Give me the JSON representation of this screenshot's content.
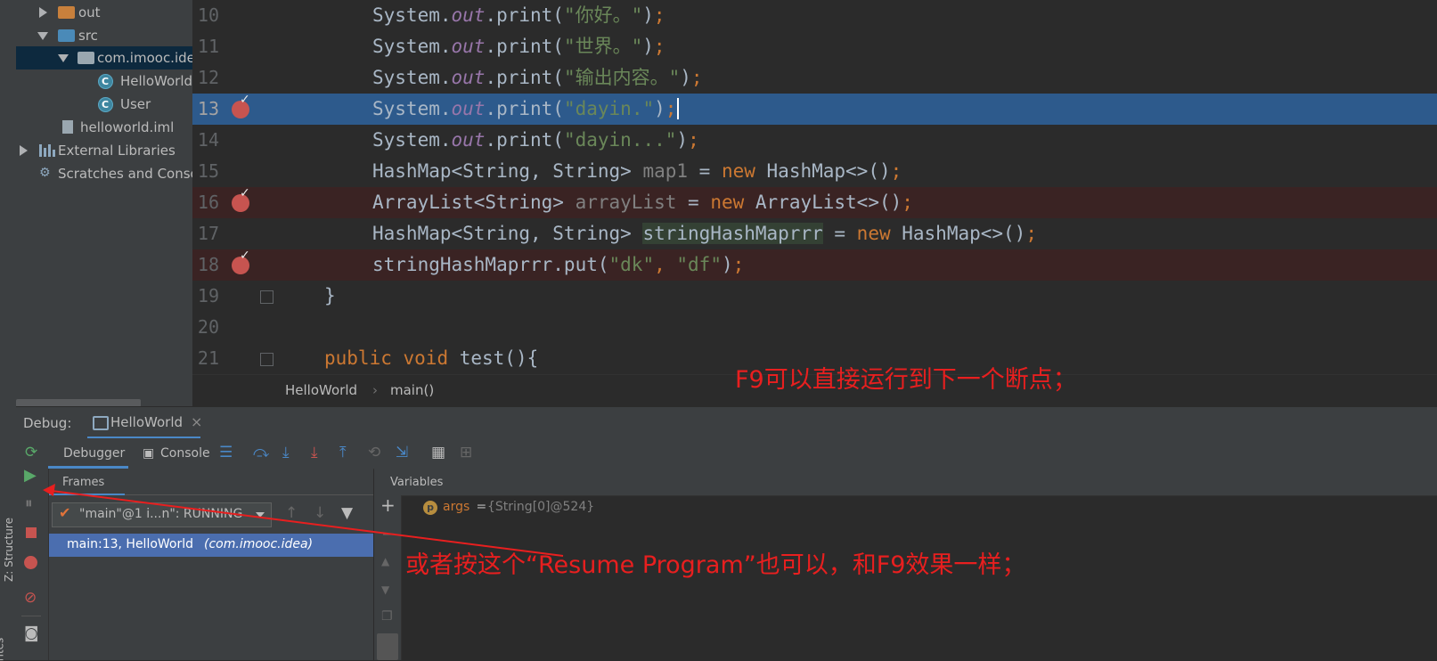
{
  "left_strip": {
    "structure_label": "Z: Structure",
    "favorites_label": "rites"
  },
  "project_tree": {
    "items": [
      {
        "label": "out",
        "kind": "folder"
      },
      {
        "label": "src",
        "kind": "folder"
      },
      {
        "label": "com.imooc.idea",
        "kind": "package"
      },
      {
        "label": "HelloWorld",
        "kind": "class"
      },
      {
        "label": "User",
        "kind": "class"
      },
      {
        "label": "helloworld.iml",
        "kind": "file"
      },
      {
        "label": "External Libraries",
        "kind": "libraries"
      },
      {
        "label": "Scratches and Consoles",
        "kind": "scratches"
      }
    ]
  },
  "editor": {
    "lines": [
      {
        "num": "10"
      },
      {
        "num": "11"
      },
      {
        "num": "12"
      },
      {
        "num": "13"
      },
      {
        "num": "14"
      },
      {
        "num": "15"
      },
      {
        "num": "16"
      },
      {
        "num": "17"
      },
      {
        "num": "18"
      },
      {
        "num": "19"
      },
      {
        "num": "20"
      },
      {
        "num": "21"
      }
    ],
    "tokens": {
      "system": "System.",
      "out": "out",
      "print": ".print(",
      "close": ")",
      "semi": ";",
      "s10": "\"你好。\"",
      "s11": "\"世界。\"",
      "s12": "\"输出内容。\"",
      "s13": "\"dayin.\"",
      "s14": "\"dayin...\"",
      "hashmap_decl": "HashMap<String, String> ",
      "map1": "map1",
      "assign": " = ",
      "new_kw": "new",
      "hashmap_new": " HashMap<>()",
      "arraylist_decl": "ArrayList<String> ",
      "arrayList": "arrayList",
      "arraylist_new": " ArrayList<>()",
      "stringHashMaprrr": "stringHashMaprrr",
      "put_call": "stringHashMaprrr.put(",
      "dk": "\"dk\"",
      "comma": ", ",
      "df": "\"df\"",
      "brace_close": "}",
      "public_kw": "public",
      "void_kw": "void",
      "test": " test(){"
    },
    "breadcrumb": [
      "HelloWorld",
      "main()"
    ],
    "annotation": "F9可以直接运行到下一个断点；"
  },
  "debug": {
    "label": "Debug:",
    "session_tab": "HelloWorld",
    "close_glyph": "×",
    "tabs": [
      "Debugger",
      "Console"
    ],
    "frames_title": "Frames",
    "variables_title": "Variables",
    "thread": "\"main\"@1 i...n\": RUNNING",
    "frame_location": "main:13, HelloWorld",
    "frame_package": "(com.imooc.idea)",
    "variable": {
      "badge": "p",
      "name": "args",
      "equals": " = ",
      "value": "{String[0]@524}"
    },
    "annotation": "或者按这个“Resume Program”也可以，和F9效果一样；"
  },
  "colors": {
    "breakpoint": "#c75450",
    "current_line": "#2d5a8c",
    "annotation": "#e81f1f",
    "keyword": "#cc7832",
    "string": "#6a8759",
    "field": "#9876aa"
  }
}
